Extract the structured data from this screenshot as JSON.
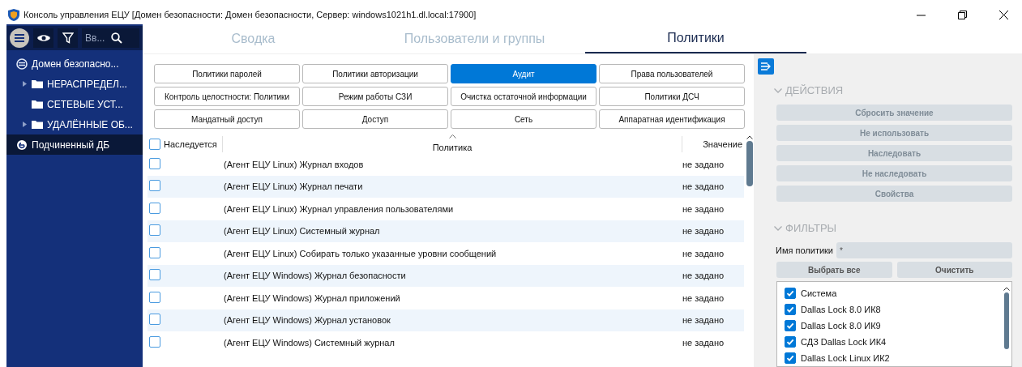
{
  "window": {
    "title": "Консоль управления ЕЦУ [Домен безопасности: Домен безопасности, Сервер: windows1021h1.dl.local:17900]"
  },
  "sidebar": {
    "search": {
      "placeholder": "Вв..."
    },
    "tree": [
      {
        "label": "Домен безопасно...",
        "kind": "domain",
        "selected": false,
        "children": [
          {
            "label": "НЕРАСПРЕДЕЛ...",
            "kind": "folder",
            "selected": false,
            "expanded": false,
            "has_children": true
          },
          {
            "label": "СЕТЕВЫЕ УСТ...",
            "kind": "folder",
            "selected": false,
            "has_children": false
          },
          {
            "label": "УДАЛЁННЫЕ ОБ...",
            "kind": "folder",
            "selected": false,
            "expanded": false,
            "has_children": true
          }
        ]
      },
      {
        "label": "Подчиненный ДБ",
        "kind": "subdomain",
        "selected": true
      }
    ]
  },
  "tabs": [
    {
      "label": "Сводка",
      "selected": false
    },
    {
      "label": "Пользователи и группы",
      "selected": false
    },
    {
      "label": "Политики",
      "selected": true
    }
  ],
  "categories": [
    {
      "label": "Политики паролей",
      "selected": false
    },
    {
      "label": "Политики авторизации",
      "selected": false
    },
    {
      "label": "Аудит",
      "selected": true
    },
    {
      "label": "Права пользователей",
      "selected": false
    },
    {
      "label": "Контроль целостности: Политики",
      "selected": false
    },
    {
      "label": "Режим работы СЗИ",
      "selected": false
    },
    {
      "label": "Очистка остаточной информации",
      "selected": false
    },
    {
      "label": "Политики ДСЧ",
      "selected": false
    },
    {
      "label": "Мандатный доступ",
      "selected": false
    },
    {
      "label": "Доступ",
      "selected": false
    },
    {
      "label": "Сеть",
      "selected": false
    },
    {
      "label": "Аппаратная идентификация",
      "selected": false
    }
  ],
  "table": {
    "columns": [
      {
        "label": "Наследуется",
        "checked": false
      },
      {
        "label": "Политика",
        "sorted": true
      },
      {
        "label": "Значение"
      }
    ],
    "rows": [
      {
        "inherited": false,
        "policy": "(Агент ЕЦУ Linux) Журнал входов",
        "value": "не задано"
      },
      {
        "inherited": false,
        "policy": "(Агент ЕЦУ Linux) Журнал печати",
        "value": "не задано"
      },
      {
        "inherited": false,
        "policy": "(Агент ЕЦУ Linux) Журнал управления пользователями",
        "value": "не задано"
      },
      {
        "inherited": false,
        "policy": "(Агент ЕЦУ Linux) Системный журнал",
        "value": "не задано"
      },
      {
        "inherited": false,
        "policy": "(Агент ЕЦУ Linux) Собирать только указанные уровни сообщений",
        "value": "не задано"
      },
      {
        "inherited": false,
        "policy": "(Агент ЕЦУ Windows) Журнал безопасности",
        "value": "не задано"
      },
      {
        "inherited": false,
        "policy": "(Агент ЕЦУ Windows) Журнал приложений",
        "value": "не задано"
      },
      {
        "inherited": false,
        "policy": "(Агент ЕЦУ Windows) Журнал установок",
        "value": "не задано"
      },
      {
        "inherited": false,
        "policy": "(Агент ЕЦУ Windows) Системный журнал",
        "value": "не задано"
      }
    ]
  },
  "actions": {
    "title": "ДЕЙСТВИЯ",
    "expanded": true,
    "buttons": [
      {
        "label": "Сбросить значение",
        "disabled": true
      },
      {
        "label": "Не использовать",
        "disabled": true
      },
      {
        "label": "Наследовать",
        "disabled": true
      },
      {
        "label": "Не наследовать",
        "disabled": true
      },
      {
        "label": "Свойства",
        "disabled": true
      }
    ]
  },
  "filters": {
    "title": "ФИЛЬТРЫ",
    "expanded": true,
    "name_label": "Имя политики",
    "name_value": "*",
    "buttons": [
      {
        "label": "Выбрать все",
        "disabled": false
      },
      {
        "label": "Очистить",
        "disabled": false
      }
    ],
    "items": [
      {
        "label": "Система",
        "checked": true
      },
      {
        "label": "Dallas Lock 8.0 ИК8",
        "checked": true
      },
      {
        "label": "Dallas Lock 8.0 ИК9",
        "checked": true
      },
      {
        "label": "СДЗ Dallas Lock ИК4",
        "checked": true
      },
      {
        "label": "Dallas Lock Linux ИК2",
        "checked": true
      }
    ]
  }
}
